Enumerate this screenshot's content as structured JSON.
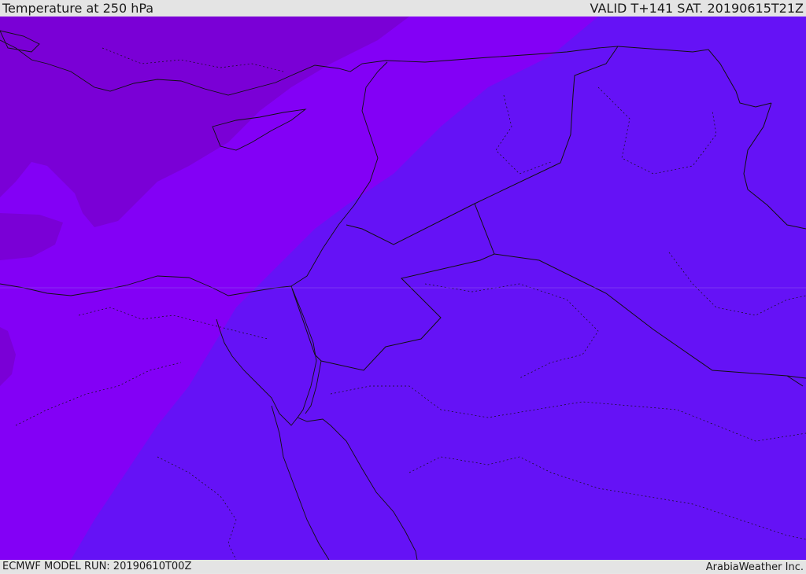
{
  "header": {
    "title": "Temperature at 250 hPa",
    "valid": "VALID T+141 SAT. 20190615T21Z"
  },
  "footer": {
    "model_run": "ECMWF MODEL RUN: 20190610T00Z",
    "credit": "ArabiaWeather Inc."
  },
  "colors": {
    "coldest": "#7a00d6",
    "cold": "#8300f6",
    "cool": "#6512f6",
    "border": "#111111"
  }
}
